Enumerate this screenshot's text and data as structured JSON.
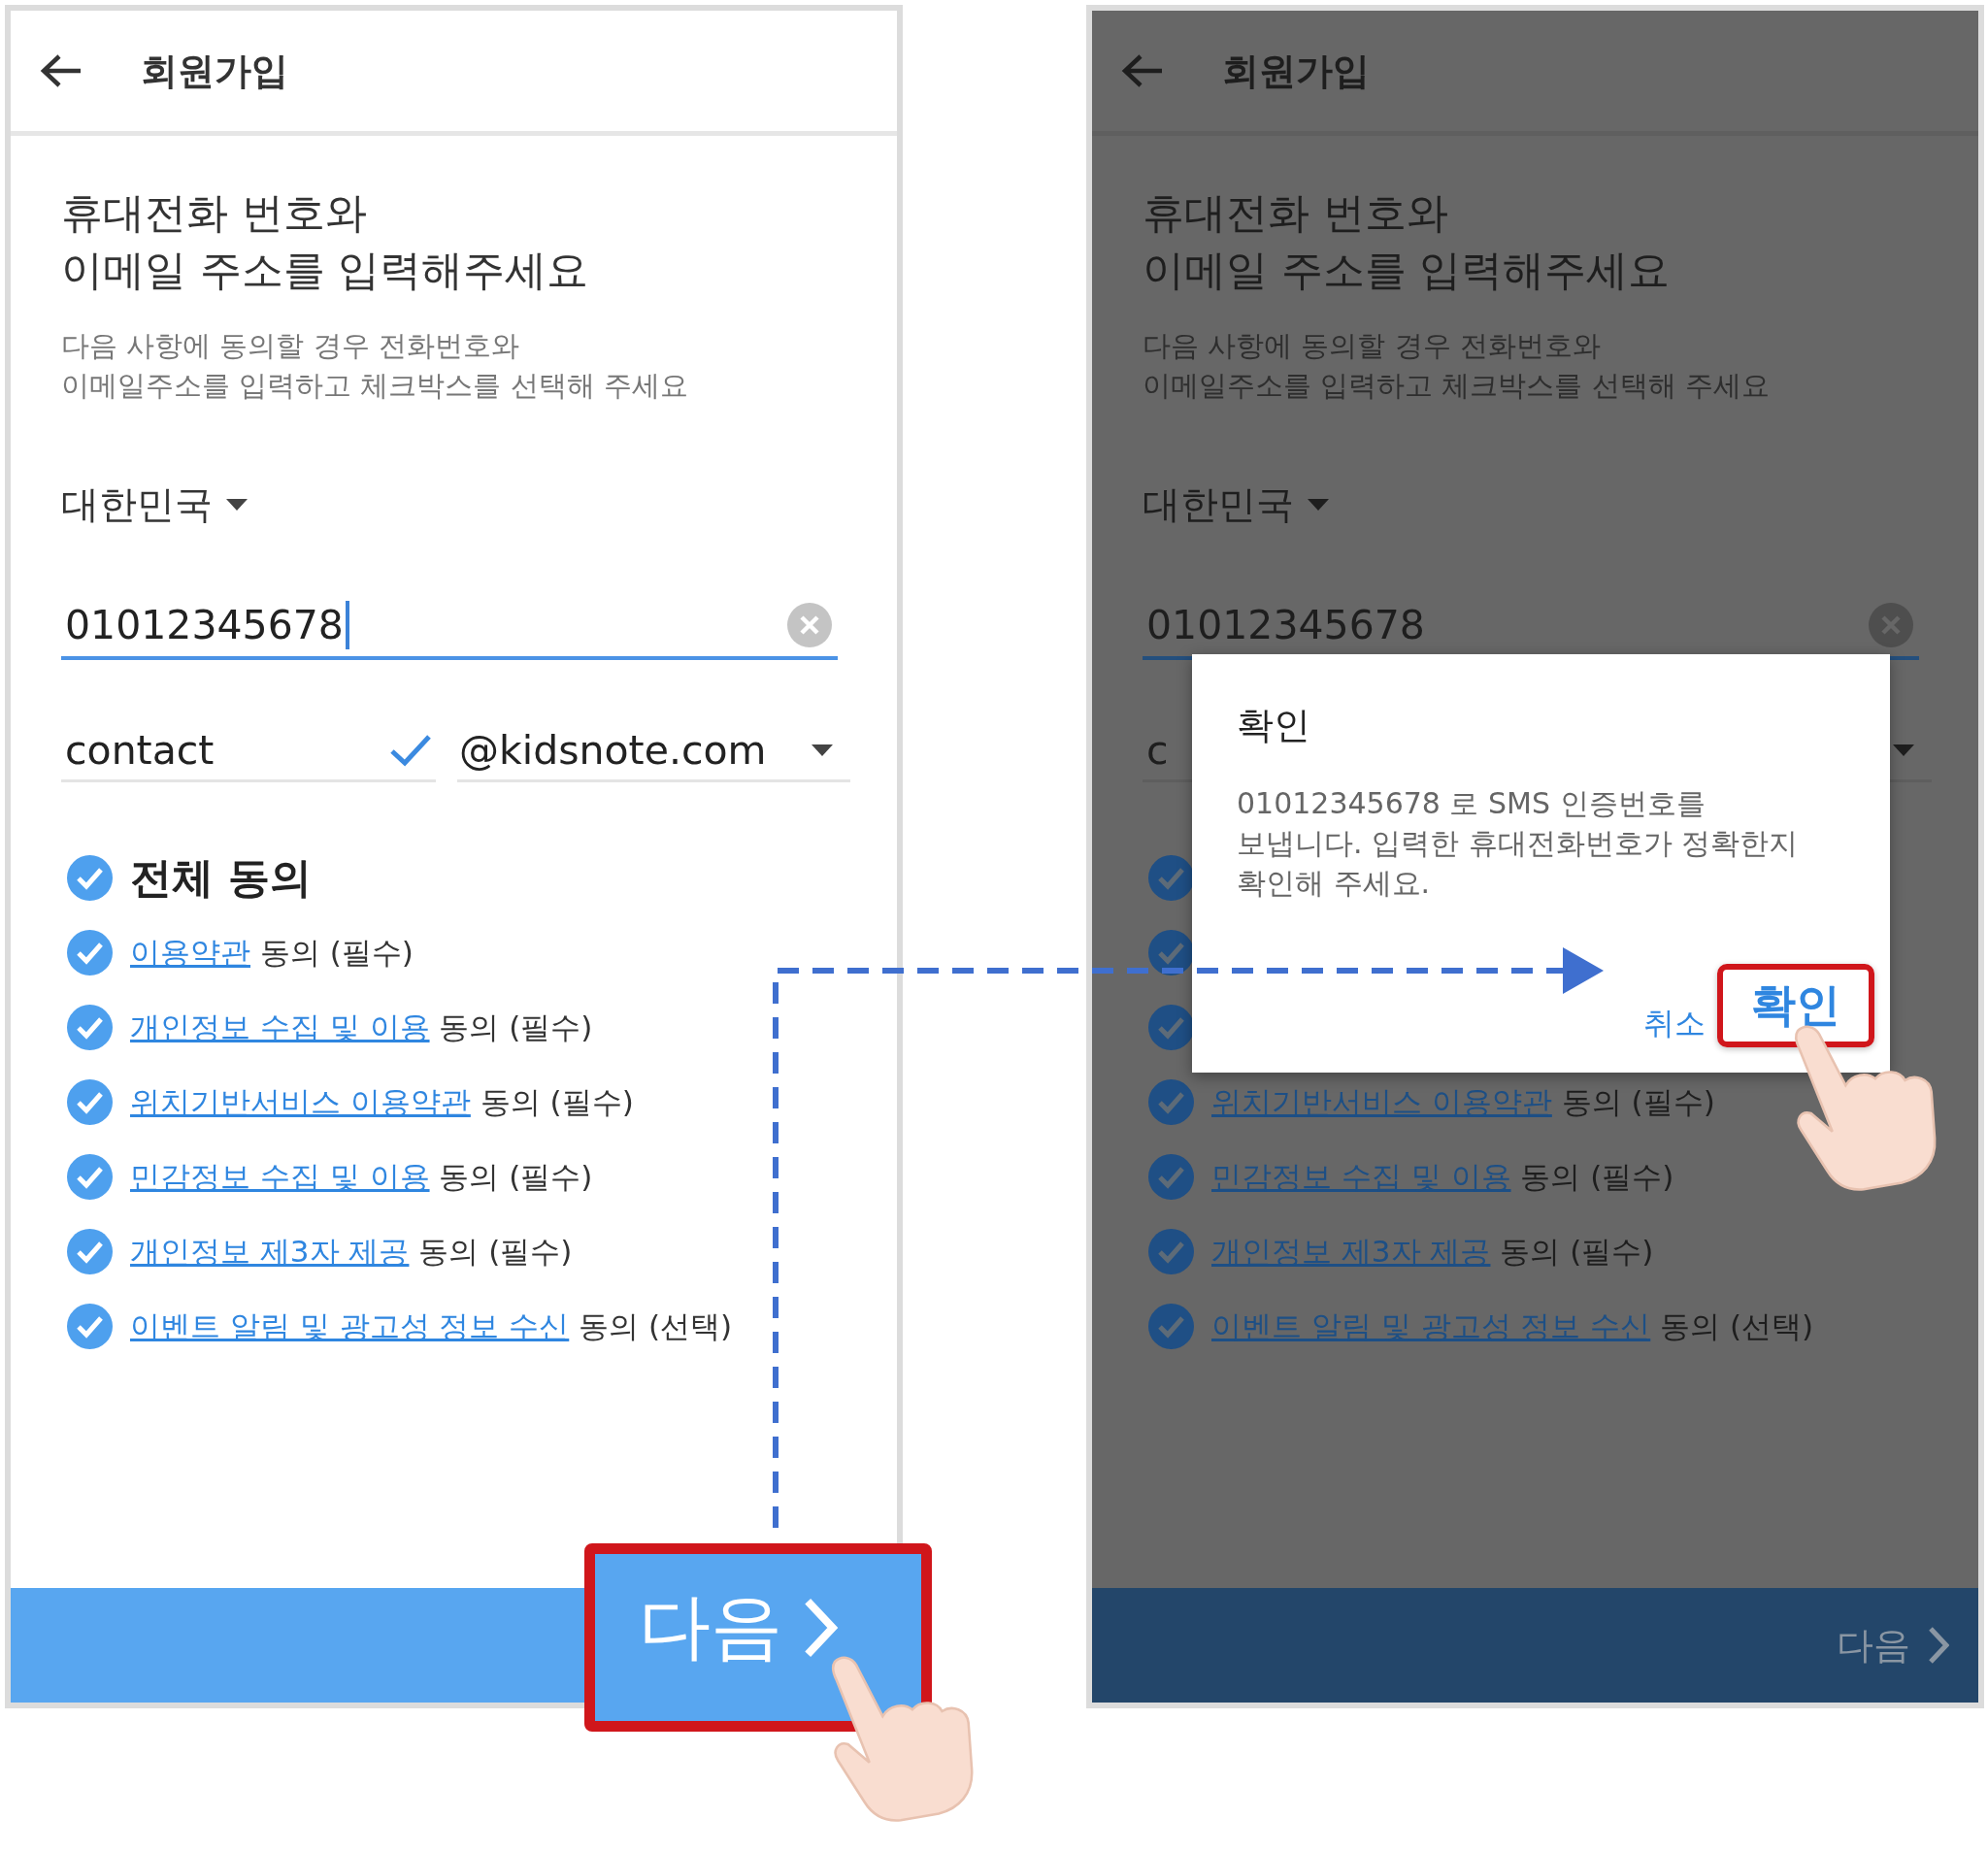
{
  "screens": [
    {
      "dimmed": false,
      "header": {
        "title": "회원가입"
      },
      "heading": "휴대전화 번호와\n이메일 주소를 입력해주세요",
      "subtitle": "다음 사항에 동의할 경우 전화번호와\n이메일주소를 입력하고 체크박스를 선택해 주세요",
      "country": "대한민국",
      "phone": {
        "value": "01012345678",
        "focused": true
      },
      "email": {
        "local": "contact",
        "valid": true,
        "domain": "@kidsnote.com"
      },
      "agreements": [
        {
          "kind": "all",
          "checked": true,
          "label": "전체 동의"
        },
        {
          "kind": "item",
          "checked": true,
          "link": "이용약관",
          "suffix": " 동의 (필수)"
        },
        {
          "kind": "item",
          "checked": true,
          "link": "개인정보 수집 및 이용",
          "suffix": " 동의 (필수)"
        },
        {
          "kind": "item",
          "checked": true,
          "link": "위치기반서비스 이용약관",
          "suffix": " 동의 (필수)"
        },
        {
          "kind": "item",
          "checked": true,
          "link": "민감정보 수집 및 이용",
          "suffix": " 동의 (필수)"
        },
        {
          "kind": "item",
          "checked": true,
          "link": "개인정보 제3자 제공",
          "suffix": " 동의 (필수)"
        },
        {
          "kind": "item",
          "checked": true,
          "link": "이벤트 알림 및 광고성 정보 수신",
          "suffix": " 동의 (선택)"
        }
      ],
      "next_button": {
        "label": "다음",
        "highlighted": true
      }
    },
    {
      "dimmed": true,
      "header": {
        "title": "회원가입"
      },
      "heading": "휴대전화 번호와\n이메일 주소를 입력해주세요",
      "subtitle": "다음 사항에 동의할 경우 전화번호와\n이메일주소를 입력하고 체크박스를 선택해 주세요",
      "country": "대한민국",
      "phone": {
        "value": "01012345678",
        "focused": false
      },
      "email": {
        "local": "c"
      },
      "agreements": [
        {
          "kind": "all",
          "checked": true
        },
        {
          "kind": "item",
          "checked": true
        },
        {
          "kind": "item",
          "checked": true
        },
        {
          "kind": "item",
          "checked": true,
          "link": "위치기반서비스 이용약관",
          "suffix": " 동의 (필수)"
        },
        {
          "kind": "item",
          "checked": true,
          "link": "민감정보 수집 및 이용",
          "suffix": " 동의 (필수)"
        },
        {
          "kind": "item",
          "checked": true,
          "link": "개인정보 제3자 제공",
          "suffix": " 동의 (필수)"
        },
        {
          "kind": "item",
          "checked": true,
          "link": "이벤트 알림 및 광고성 정보 수신",
          "suffix": " 동의 (선택)"
        }
      ],
      "next_button": {
        "label": "다음",
        "highlighted": false
      },
      "dialog": {
        "title": "확인",
        "message": "01012345678 로 SMS 인증번호를\n보냅니다. 입력한 휴대전화번호가 정확한지\n확인해 주세요.",
        "buttons": [
          {
            "label": "취소",
            "highlighted": false
          },
          {
            "label": "확인",
            "highlighted": true
          }
        ]
      }
    }
  ]
}
